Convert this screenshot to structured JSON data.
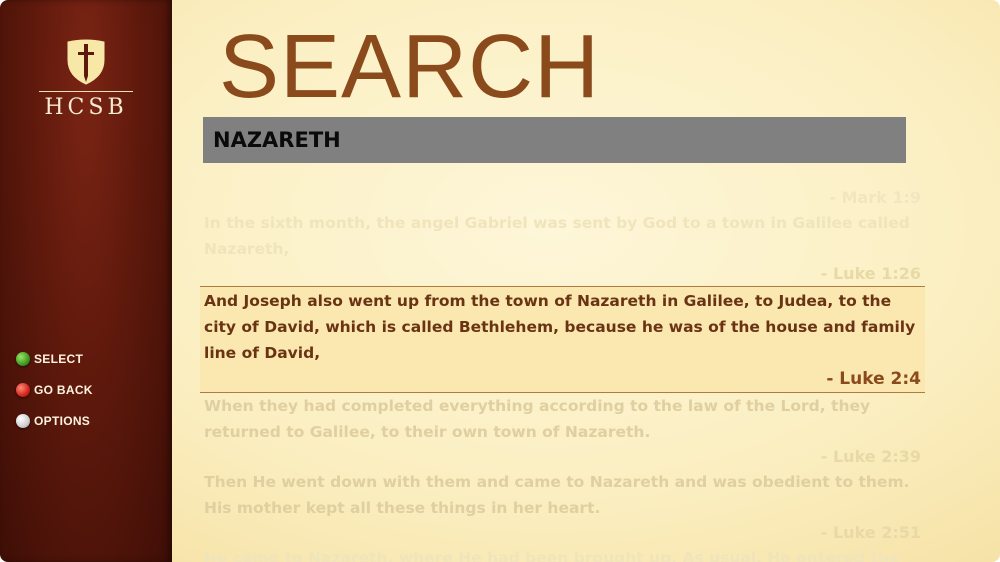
{
  "sidebar": {
    "brand": "HCSB",
    "controls": [
      {
        "icon": "green-a-button-icon",
        "label": "SELECT"
      },
      {
        "icon": "red-b-button-icon",
        "label": "GO BACK"
      },
      {
        "icon": "menu-button-icon",
        "label": "OPTIONS"
      }
    ]
  },
  "main": {
    "title": "SEARCH",
    "search_query": "NAZARETH",
    "results": [
      {
        "ref": "- Mark 1:9",
        "text": ""
      },
      {
        "ref": "",
        "text": "In the sixth month, the angel Gabriel was sent by God to a town in Galilee called Nazareth,"
      },
      {
        "ref": "- Luke 1:26",
        "text": "And Joseph also went up from the town of Nazareth in Galilee, to Judea, to the city of David, which is called Bethlehem, because he was of the house and family line of David,"
      },
      {
        "ref": "- Luke 2:4",
        "text": "When they had completed everything according to the law of the Lord, they returned to Galilee, to their own town of Nazareth."
      },
      {
        "ref": "- Luke 2:39",
        "text": "Then He went down with them and came to Nazareth and was obedient to them. His mother kept all these things in her heart."
      },
      {
        "ref": "- Luke 2:51",
        "text": "He came to Nazareth, where He had been brought up. As usual, He entered the"
      }
    ]
  },
  "colors": {
    "title": "#8a4a1c",
    "search_bar": "#808080",
    "sidebar": "#5e190c",
    "selected_text": "#6a3414"
  }
}
